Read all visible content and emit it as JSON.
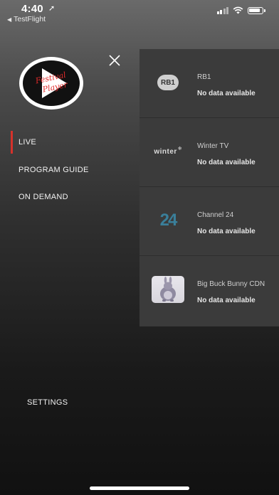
{
  "status_bar": {
    "time": "4:40",
    "back_app": "TestFlight"
  },
  "logo": {
    "line1": "Festival",
    "line2": "Player"
  },
  "menu": {
    "items": [
      {
        "label": "LIVE",
        "active": true
      },
      {
        "label": "PROGRAM GUIDE",
        "active": false
      },
      {
        "label": "ON DEMAND",
        "active": false
      }
    ],
    "settings": "SETTINGS"
  },
  "channels": [
    {
      "name": "RB1",
      "logo_text": "RB1",
      "status": "No data available"
    },
    {
      "name": "Winter TV",
      "logo_text": "winter",
      "status": "No data available"
    },
    {
      "name": "Channel 24",
      "logo_text": "24",
      "status": "No data available"
    },
    {
      "name": "Big Buck Bunny CDN",
      "logo_text": "",
      "status": "No data available"
    }
  ],
  "colors": {
    "accent": "#d6322b",
    "panel": "#3b3b3b",
    "c24": "#3a7f9a"
  }
}
